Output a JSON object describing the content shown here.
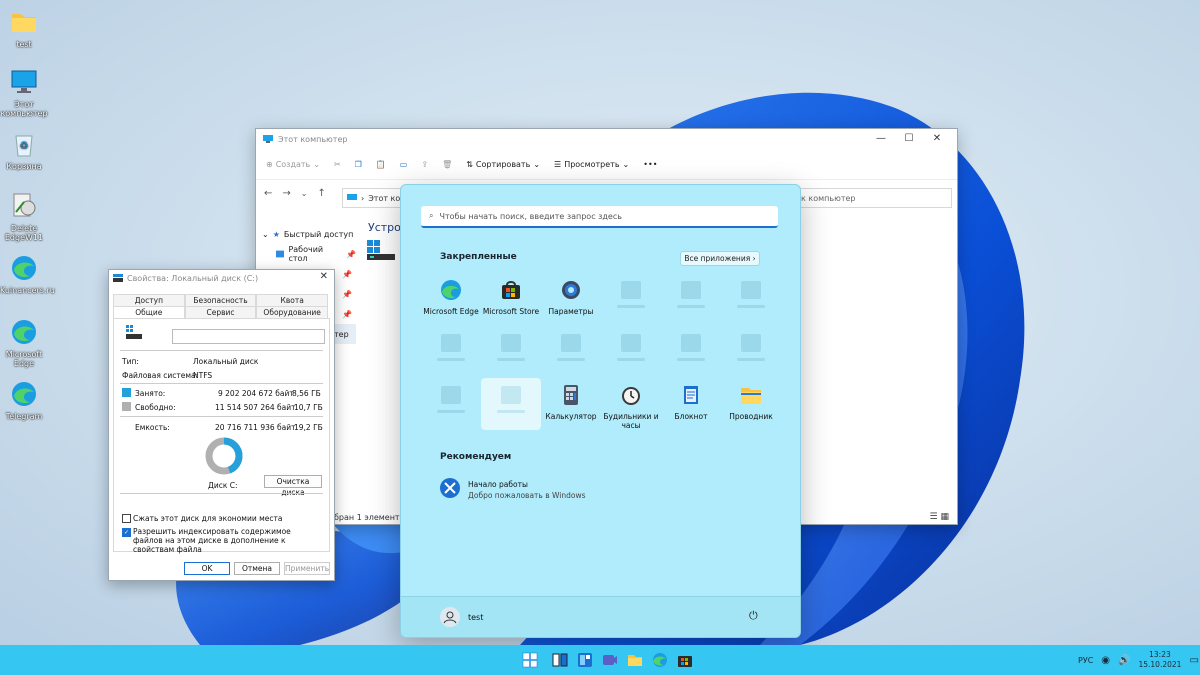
{
  "desktop": {
    "icons": [
      {
        "label": "test"
      },
      {
        "label": "Этот компьютер"
      },
      {
        "label": "Корзина"
      },
      {
        "label": "Delete EdgeW11"
      },
      {
        "label": "Kuinancers.ru"
      },
      {
        "label": "Microsoft Edge"
      },
      {
        "label": "Telegram"
      }
    ]
  },
  "explorer": {
    "title": "Этот компьютер",
    "toolbar": {
      "create": "Создать",
      "sort": "Сортировать",
      "view": "Просмотреть",
      "more": "•••"
    },
    "address": "Этот ком",
    "address_right": "к компьютер",
    "tree": [
      {
        "label": "Быстрый доступ"
      },
      {
        "label": "Рабочий стол"
      }
    ],
    "tree_partial": "тер",
    "section_heading": "Устройс",
    "status": "бран 1 элемент"
  },
  "properties": {
    "title": "Свойства: Локальный диск (C:)",
    "tabs_top": [
      "Доступ",
      "Безопасность",
      "Квота"
    ],
    "tabs_bottom": [
      "Общие",
      "Сервис",
      "Оборудование"
    ],
    "type_label": "Тип:",
    "type_value": "Локальный диск",
    "fs_label": "Файловая система:",
    "fs_value": "NTFS",
    "used_label": "Занято:",
    "used_bytes": "9 202 204 672 байт",
    "used_gb": "8,56 ГБ",
    "free_label": "Свободно:",
    "free_bytes": "11 514 507 264 байт",
    "free_gb": "10,7 ГБ",
    "capacity_label": "Емкость:",
    "capacity_bytes": "20 716 711 936 байт",
    "capacity_gb": "19,2 ГБ",
    "used_fraction": 0.444,
    "disk_label": "Диск C:",
    "cleanup": "Очистка диска",
    "compress": "Сжать этот диск для экономии места",
    "index": "Разрешить индексировать содержимое файлов на этом диске в дополнение к свойствам файла",
    "ok": "OK",
    "cancel": "Отмена",
    "apply": "Применить",
    "colors": {
      "used": "#26a0da",
      "free": "#b0b0b0"
    }
  },
  "start": {
    "search_placeholder": "Чтобы начать поиск, введите запрос здесь",
    "pinned_title": "Закрепленные",
    "all_apps": "Все приложения  ›",
    "pinned": [
      {
        "label": "Microsoft Edge",
        "icon": "edge-icon"
      },
      {
        "label": "Microsoft Store",
        "icon": "store-icon"
      },
      {
        "label": "Параметры",
        "icon": "settings-icon"
      },
      {
        "label": "Калькулятор",
        "icon": "calculator-icon"
      },
      {
        "label": "Будильники и часы",
        "icon": "alarm-clock-icon"
      },
      {
        "label": "Блокнот",
        "icon": "notepad-icon"
      },
      {
        "label": "Проводник",
        "icon": "folder-icon"
      }
    ],
    "recommended_title": "Рекомендуем",
    "recommended": [
      {
        "title": "Начало работы",
        "subtitle": "Добро пожаловать в Windows"
      }
    ],
    "user": "test"
  },
  "taskbar": {
    "lang": "РУС",
    "time": "13:23",
    "date": "15.10.2021",
    "accent": "#35c6f1"
  }
}
